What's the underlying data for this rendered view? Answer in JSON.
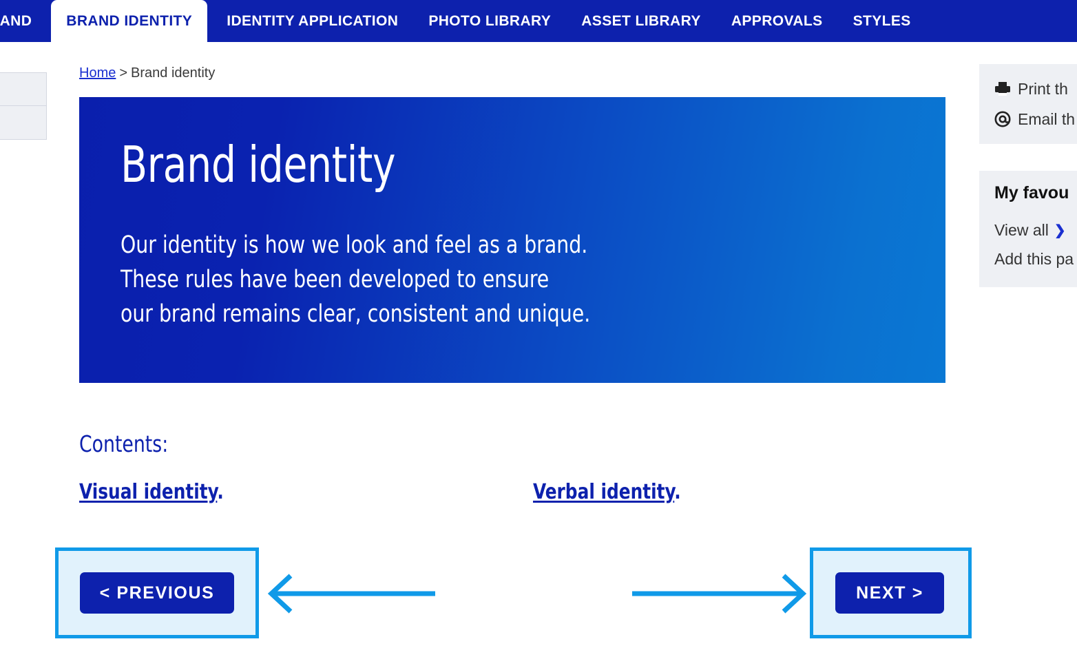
{
  "topnav": {
    "background_color": "#0d21ad",
    "active_tab_index": 1,
    "tabs": [
      {
        "label": "RAND",
        "active": false,
        "clipped": true
      },
      {
        "label": "BRAND IDENTITY",
        "active": true,
        "clipped": false
      },
      {
        "label": "IDENTITY APPLICATION",
        "active": false,
        "clipped": false
      },
      {
        "label": "PHOTO LIBRARY",
        "active": false,
        "clipped": false
      },
      {
        "label": "ASSET LIBRARY",
        "active": false,
        "clipped": false
      },
      {
        "label": "APPROVALS",
        "active": false,
        "clipped": false
      },
      {
        "label": "STYLES",
        "active": false,
        "clipped": false
      }
    ]
  },
  "breadcrumb": {
    "home_label": "Home",
    "separator": ">",
    "current_label": "Brand identity"
  },
  "hero": {
    "title": "Brand identity",
    "body_lines": [
      "Our identity is how we look and feel as a brand.",
      "These rules have been developed to ensure",
      "our brand remains clear, consistent and unique."
    ],
    "gradient_from": "#0a1fad",
    "gradient_to": "#0a78d4"
  },
  "contents": {
    "heading": "Contents:",
    "links": [
      {
        "label": "Visual identity",
        "trailing": "."
      },
      {
        "label": "Verbal identity",
        "trailing": "."
      }
    ]
  },
  "pagination": {
    "previous_label": "< PREVIOUS",
    "next_label": "NEXT >",
    "button_color": "#0d21ad",
    "highlight_border_color": "#109ae8",
    "highlight_fill_color": "#e1f2fc",
    "annotation_arrow_color": "#109ae8"
  },
  "sidebar": {
    "actions": [
      {
        "icon": "printer-icon",
        "label": "Print th"
      },
      {
        "icon": "at-sign-icon",
        "label": "Email th"
      }
    ],
    "favourites": {
      "title": "My favou",
      "view_all_label": "View all",
      "view_all_chevron": "❯",
      "add_page_label": "Add this pa"
    }
  },
  "left_panel": {
    "rows": [
      "",
      ""
    ]
  }
}
